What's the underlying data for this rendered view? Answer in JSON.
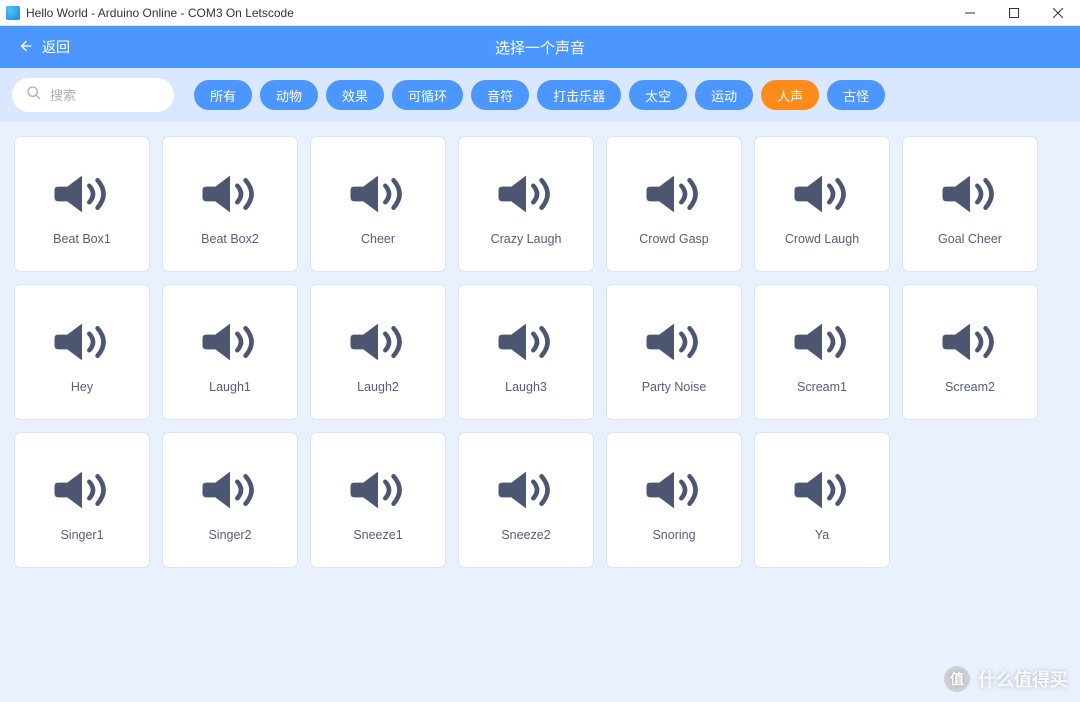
{
  "window": {
    "title": "Hello World - Arduino Online - COM3 On Letscode"
  },
  "header": {
    "back_label": "返回",
    "title": "选择一个声音"
  },
  "search": {
    "placeholder": "搜索",
    "value": ""
  },
  "categories": [
    {
      "label": "所有",
      "active": false
    },
    {
      "label": "动物",
      "active": false
    },
    {
      "label": "效果",
      "active": false
    },
    {
      "label": "可循环",
      "active": false
    },
    {
      "label": "音符",
      "active": false
    },
    {
      "label": "打击乐器",
      "active": false
    },
    {
      "label": "太空",
      "active": false
    },
    {
      "label": "运动",
      "active": false
    },
    {
      "label": "人声",
      "active": true
    },
    {
      "label": "古怪",
      "active": false
    }
  ],
  "sounds": [
    {
      "label": "Beat Box1"
    },
    {
      "label": "Beat Box2"
    },
    {
      "label": "Cheer"
    },
    {
      "label": "Crazy Laugh"
    },
    {
      "label": "Crowd Gasp"
    },
    {
      "label": "Crowd Laugh"
    },
    {
      "label": "Goal Cheer"
    },
    {
      "label": "Hey"
    },
    {
      "label": "Laugh1"
    },
    {
      "label": "Laugh2"
    },
    {
      "label": "Laugh3"
    },
    {
      "label": "Party Noise"
    },
    {
      "label": "Scream1"
    },
    {
      "label": "Scream2"
    },
    {
      "label": "Singer1"
    },
    {
      "label": "Singer2"
    },
    {
      "label": "Sneeze1"
    },
    {
      "label": "Sneeze2"
    },
    {
      "label": "Snoring"
    },
    {
      "label": "Ya"
    }
  ],
  "icon_color": "#4c5671",
  "watermark": {
    "badge": "值",
    "text": "什么值得买"
  }
}
